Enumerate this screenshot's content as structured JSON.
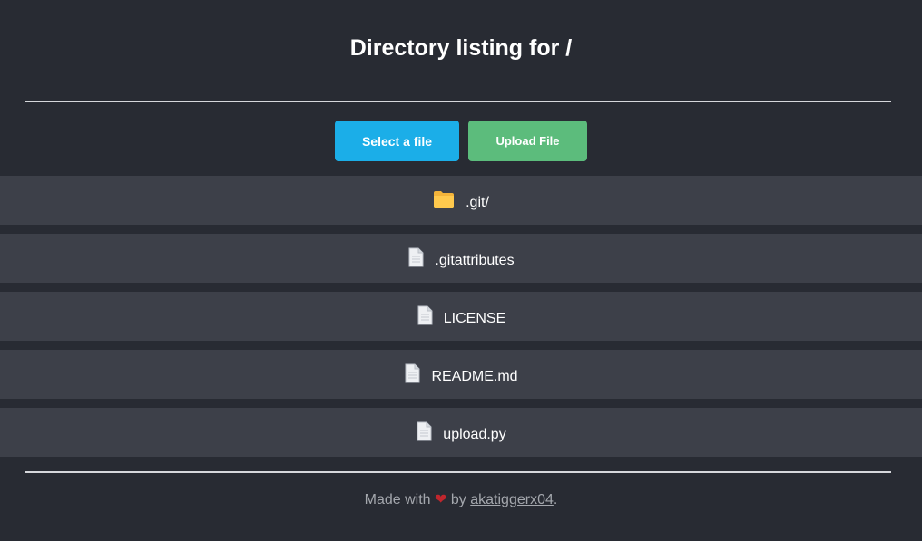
{
  "header": {
    "title": "Directory listing for /"
  },
  "actions": {
    "select_label": "Select a file",
    "upload_label": "Upload File"
  },
  "files": [
    {
      "name": ".git/",
      "icon": "folder-icon"
    },
    {
      "name": ".gitattributes",
      "icon": "file-icon"
    },
    {
      "name": "LICENSE",
      "icon": "file-icon"
    },
    {
      "name": "README.md",
      "icon": "file-icon"
    },
    {
      "name": "upload.py",
      "icon": "file-icon"
    }
  ],
  "footer": {
    "prefix": "Made with",
    "heart": "❤",
    "by": "by",
    "author": "akatiggerx04",
    "suffix": "."
  },
  "colors": {
    "background": "#282b33",
    "row": "#3d4049",
    "select_button": "#1baee8",
    "upload_button": "#5cbc7c",
    "heart": "#c0262d"
  }
}
